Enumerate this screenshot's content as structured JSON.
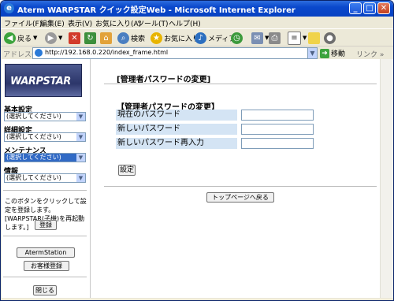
{
  "window": {
    "title": "Aterm WARPSTAR クイック設定Web - Microsoft Internet Explorer",
    "controls": {
      "minimize": "_",
      "maximize": "□",
      "close": "✕"
    }
  },
  "menubar": {
    "items": [
      "ファイル(F)",
      "編集(E)",
      "表示(V)",
      "お気に入り(A)",
      "ツール(T)",
      "ヘルプ(H)"
    ]
  },
  "toolbar": {
    "back_label": "戻る",
    "search_label": "検索",
    "favorites_label": "お気に入り",
    "media_label": "メディア"
  },
  "address": {
    "label": "アドレス(D)",
    "url": "http://192.168.0.220/index_frame.html",
    "go_label": "移動",
    "links_label": "リンク"
  },
  "sidebar": {
    "logo": "WARPSTAR",
    "sections": [
      {
        "label": "基本設定",
        "value": "(選択してください)"
      },
      {
        "label": "詳細設定",
        "value": "(選択してください)"
      },
      {
        "label": "メンテナンス",
        "value": "(選択してください)"
      },
      {
        "label": "情報",
        "value": "(選択してください)"
      }
    ],
    "hint": "このボタンをクリックして設定を登録します。[WARPSTAR(子機)を再起動します。]",
    "register_button": "登録",
    "aterm_station_button": "AtermStation",
    "customer_register_button": "お客様登録",
    "close_button": "閉じる"
  },
  "main": {
    "page_title": "[管理者パスワードの変更]",
    "section_title": "【管理者パスワードの変更】",
    "fields": [
      {
        "label": "現在のパスワード",
        "value": ""
      },
      {
        "label": "新しいパスワード",
        "value": ""
      },
      {
        "label": "新しいパスワード再入力",
        "value": ""
      }
    ],
    "set_button": "設定",
    "top_page_button": "トップページへ戻る"
  },
  "colors": {
    "titlebar": "#0a48cc",
    "form_row_bg": "#d4e4f4",
    "selection": "#316ac5"
  }
}
